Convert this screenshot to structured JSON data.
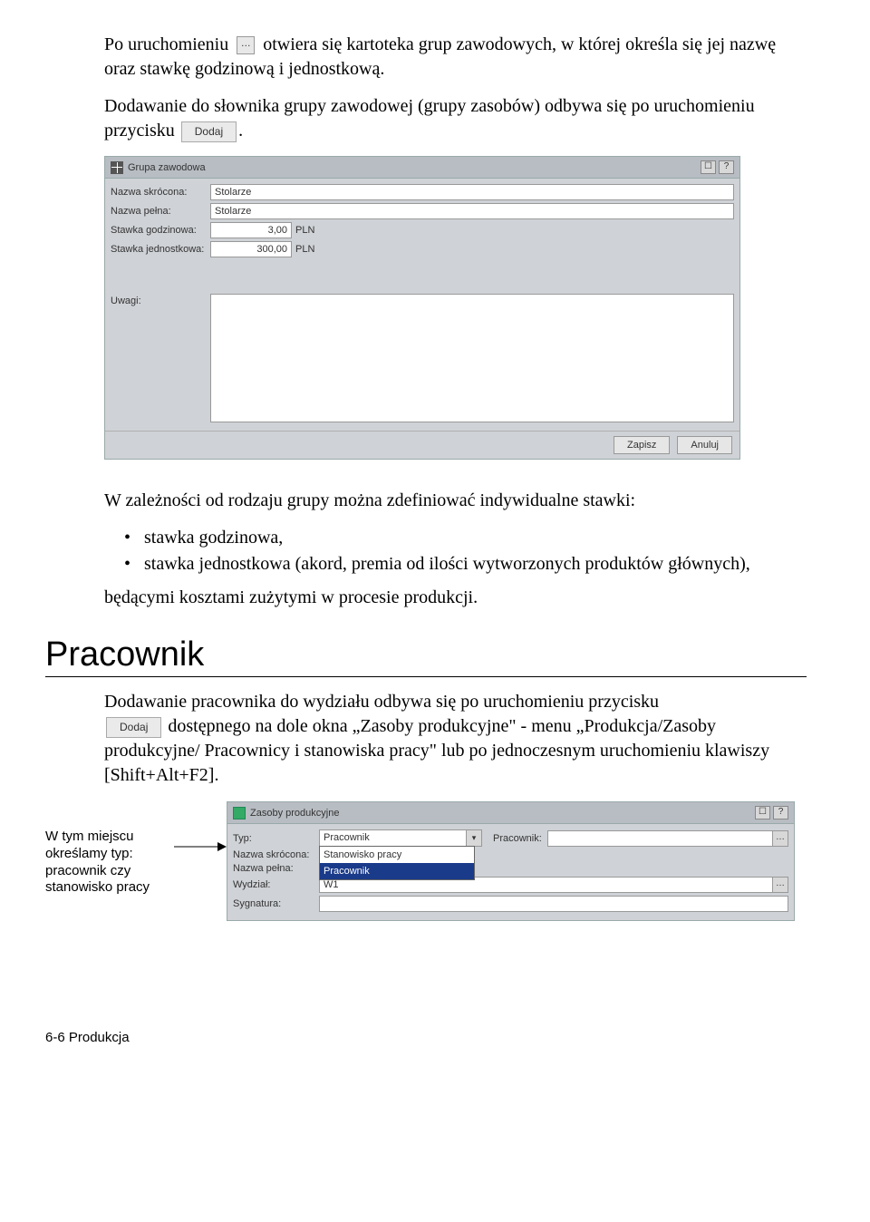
{
  "para1_a": "Po uruchomieniu",
  "para1_b": "otwiera się kartoteka grup zawodowych, w której określa się jej nazwę oraz stawkę godzinową i jednostkową.",
  "para2_a": "Dodawanie do słownika grupy zawodowej (grupy zasobów) odbywa się po uruchomieniu przycisku",
  "btn_dots": "…",
  "btn_dodaj": "Dodaj",
  "btn_period": ".",
  "win1": {
    "title": "Grupa zawodowa",
    "icon_a": "☐",
    "icon_b": "?",
    "rows": {
      "l_nazwa_sk": "Nazwa skrócona:",
      "v_nazwa_sk": "Stolarze",
      "l_nazwa_p": "Nazwa pełna:",
      "v_nazwa_p": "Stolarze",
      "l_stawka_g": "Stawka godzinowa:",
      "v_stawka_g": "3,00",
      "u_pln": "PLN",
      "l_stawka_j": "Stawka jednostkowa:",
      "v_stawka_j": "300,00",
      "l_uwagi": "Uwagi:"
    },
    "btn_zapisz": "Zapisz",
    "btn_anuluj": "Anuluj"
  },
  "para3": "W zależności od rodzaju grupy można zdefiniować indywidualne stawki:",
  "bullets": {
    "b1": "stawka godzinowa,",
    "b2": "stawka jednostkowa (akord, premia od ilości wytworzonych produktów głównych),"
  },
  "para4": "będącymi kosztami zużytymi w procesie produkcji.",
  "heading": "Pracownik",
  "para5_a": "Dodawanie pracownika do wydziału odbywa się po uruchomieniu przycisku",
  "para5_b": "dostępnego na dole okna „Zasoby produkcyjne\" - menu „Produkcja/Zasoby produkcyjne/ Pracownicy i stanowiska pracy\" lub po jednoczesnym uruchomieniu klawiszy [Shift+Alt+F2].",
  "callout": "W tym miejscu określamy typ: pracownik czy stanowisko pracy",
  "win2": {
    "title": "Zasoby produkcyjne",
    "icon_a": "☐",
    "icon_b": "?",
    "l_typ": "Typ:",
    "v_typ": "Pracownik",
    "dd_opt1": "Stanowisko pracy",
    "dd_opt2": "Pracownik",
    "l_pracownik": "Pracownik:",
    "l_nazwa_sk": "Nazwa skrócona:",
    "l_nazwa_p": "Nazwa pełna:",
    "l_wydzial": "Wydział:",
    "v_wydzial": "W1",
    "l_sygnatura": "Sygnatura:"
  },
  "footer": "6-6 Produkcja"
}
